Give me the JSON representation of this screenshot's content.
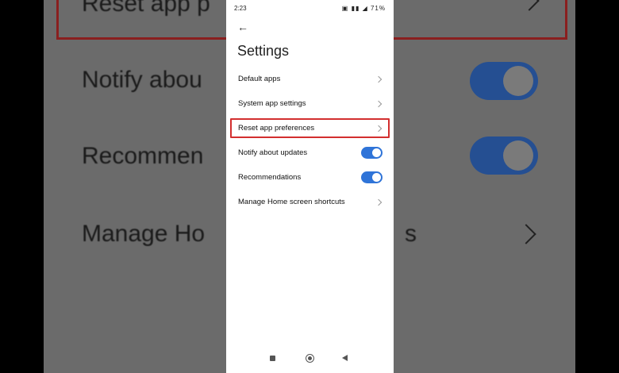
{
  "status_bar": {
    "time": "2:23",
    "icons_text": "▣ ▮▮ ◢ 71%"
  },
  "header": {
    "back_icon": "←",
    "title": "Settings"
  },
  "settings": {
    "items": [
      {
        "label": "Default apps",
        "control": "chevron"
      },
      {
        "label": "System app settings",
        "control": "chevron"
      },
      {
        "label": "Reset app preferences",
        "control": "chevron",
        "highlighted": true
      },
      {
        "label": "Notify about updates",
        "control": "toggle",
        "on": true
      },
      {
        "label": "Recommendations",
        "control": "toggle",
        "on": true
      },
      {
        "label": "Manage Home screen shortcuts",
        "control": "chevron"
      }
    ]
  },
  "background_zoom": {
    "line1": "Reset app p",
    "line2": "Notify abou",
    "line3": "Recommen",
    "line4": "Manage Ho",
    "line4_right": "s"
  },
  "colors": {
    "toggle_on": "#2f74d8",
    "highlight": "#d32f2f"
  }
}
